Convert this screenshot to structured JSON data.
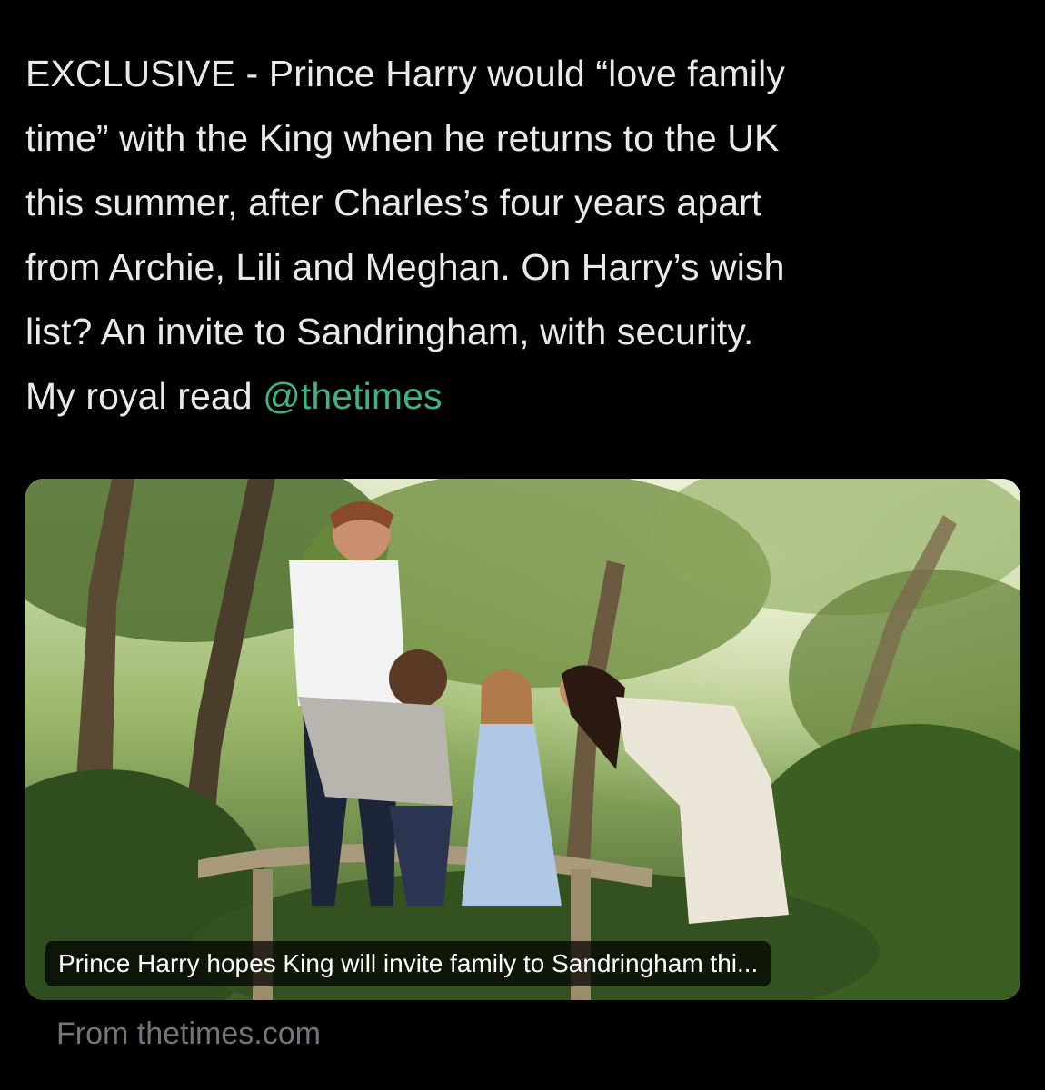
{
  "tweet": {
    "text_lines": [
      "EXCLUSIVE - Prince Harry would “love family",
      "time” with the King when he returns to the UK",
      "this summer, after Charles’s four years apart",
      "from Archie, Lili and Meghan. On Harry’s wish",
      "list? An invite to Sandringham, with security."
    ],
    "last_line_prefix": "My royal read ",
    "mention": "@thetimes"
  },
  "card": {
    "caption": "Prince Harry hopes King will invite family to Sandringham thi...",
    "source": "From thetimes.com"
  },
  "colors": {
    "background": "#000000",
    "text": "#e7e9ea",
    "mention": "#3fb37f",
    "muted": "#71767b"
  }
}
